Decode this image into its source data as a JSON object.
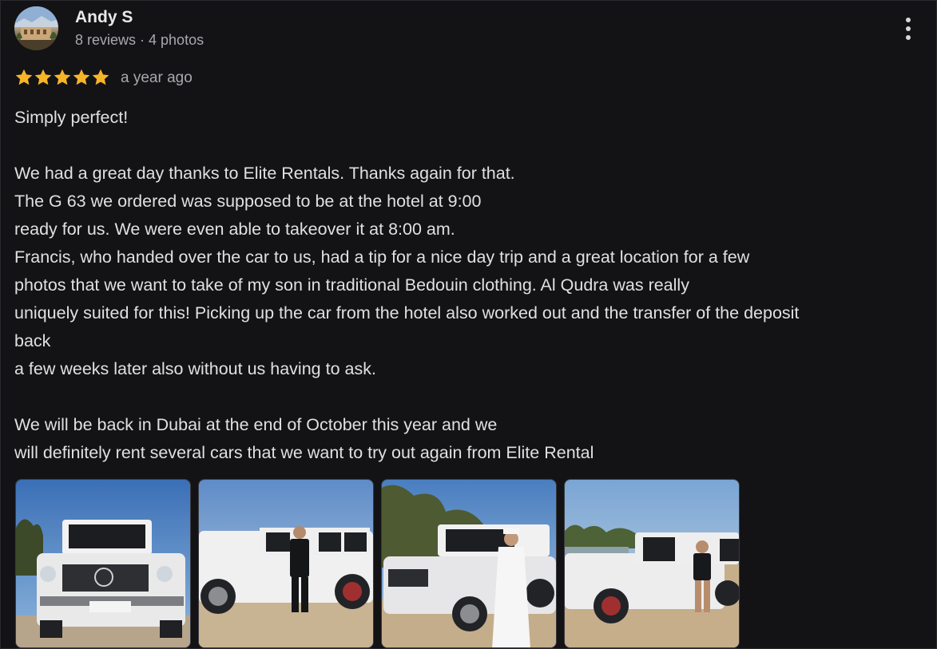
{
  "reviewer": {
    "name": "Andy S",
    "stats": "8 reviews · 4 photos"
  },
  "review": {
    "rating": 5,
    "rating_max": 5,
    "time": "a year ago",
    "lines": [
      "Simply perfect!",
      "",
      "We had a great day thanks to Elite Rentals. Thanks again for that.",
      "The G 63 we ordered was supposed to be at the hotel at 9:00",
      "ready for us. We were even able to takeover it at 8:00 am.",
      "Francis, who handed over the car to us, had a tip for a nice day trip and a great location for a few",
      "photos that we want to take of my son in traditional Bedouin clothing. Al Qudra was really",
      "uniquely suited for this! Picking up the car from the hotel also worked out and the transfer of the deposit",
      "back",
      "a few weeks later also without us having to ask.",
      "",
      "We will be back in Dubai at the end of October this year and we",
      "will definitely rent several cars that we want to try out again from Elite Rental"
    ]
  },
  "photos": [
    {
      "icon": "car-front-photo"
    },
    {
      "icon": "car-side-man-photo"
    },
    {
      "icon": "car-bedouin-photo"
    },
    {
      "icon": "car-lake-photo"
    }
  ],
  "colors": {
    "background": "#131316",
    "star": "#f6b529",
    "text": "#e0e0e0",
    "muted": "#a8a8ad"
  }
}
